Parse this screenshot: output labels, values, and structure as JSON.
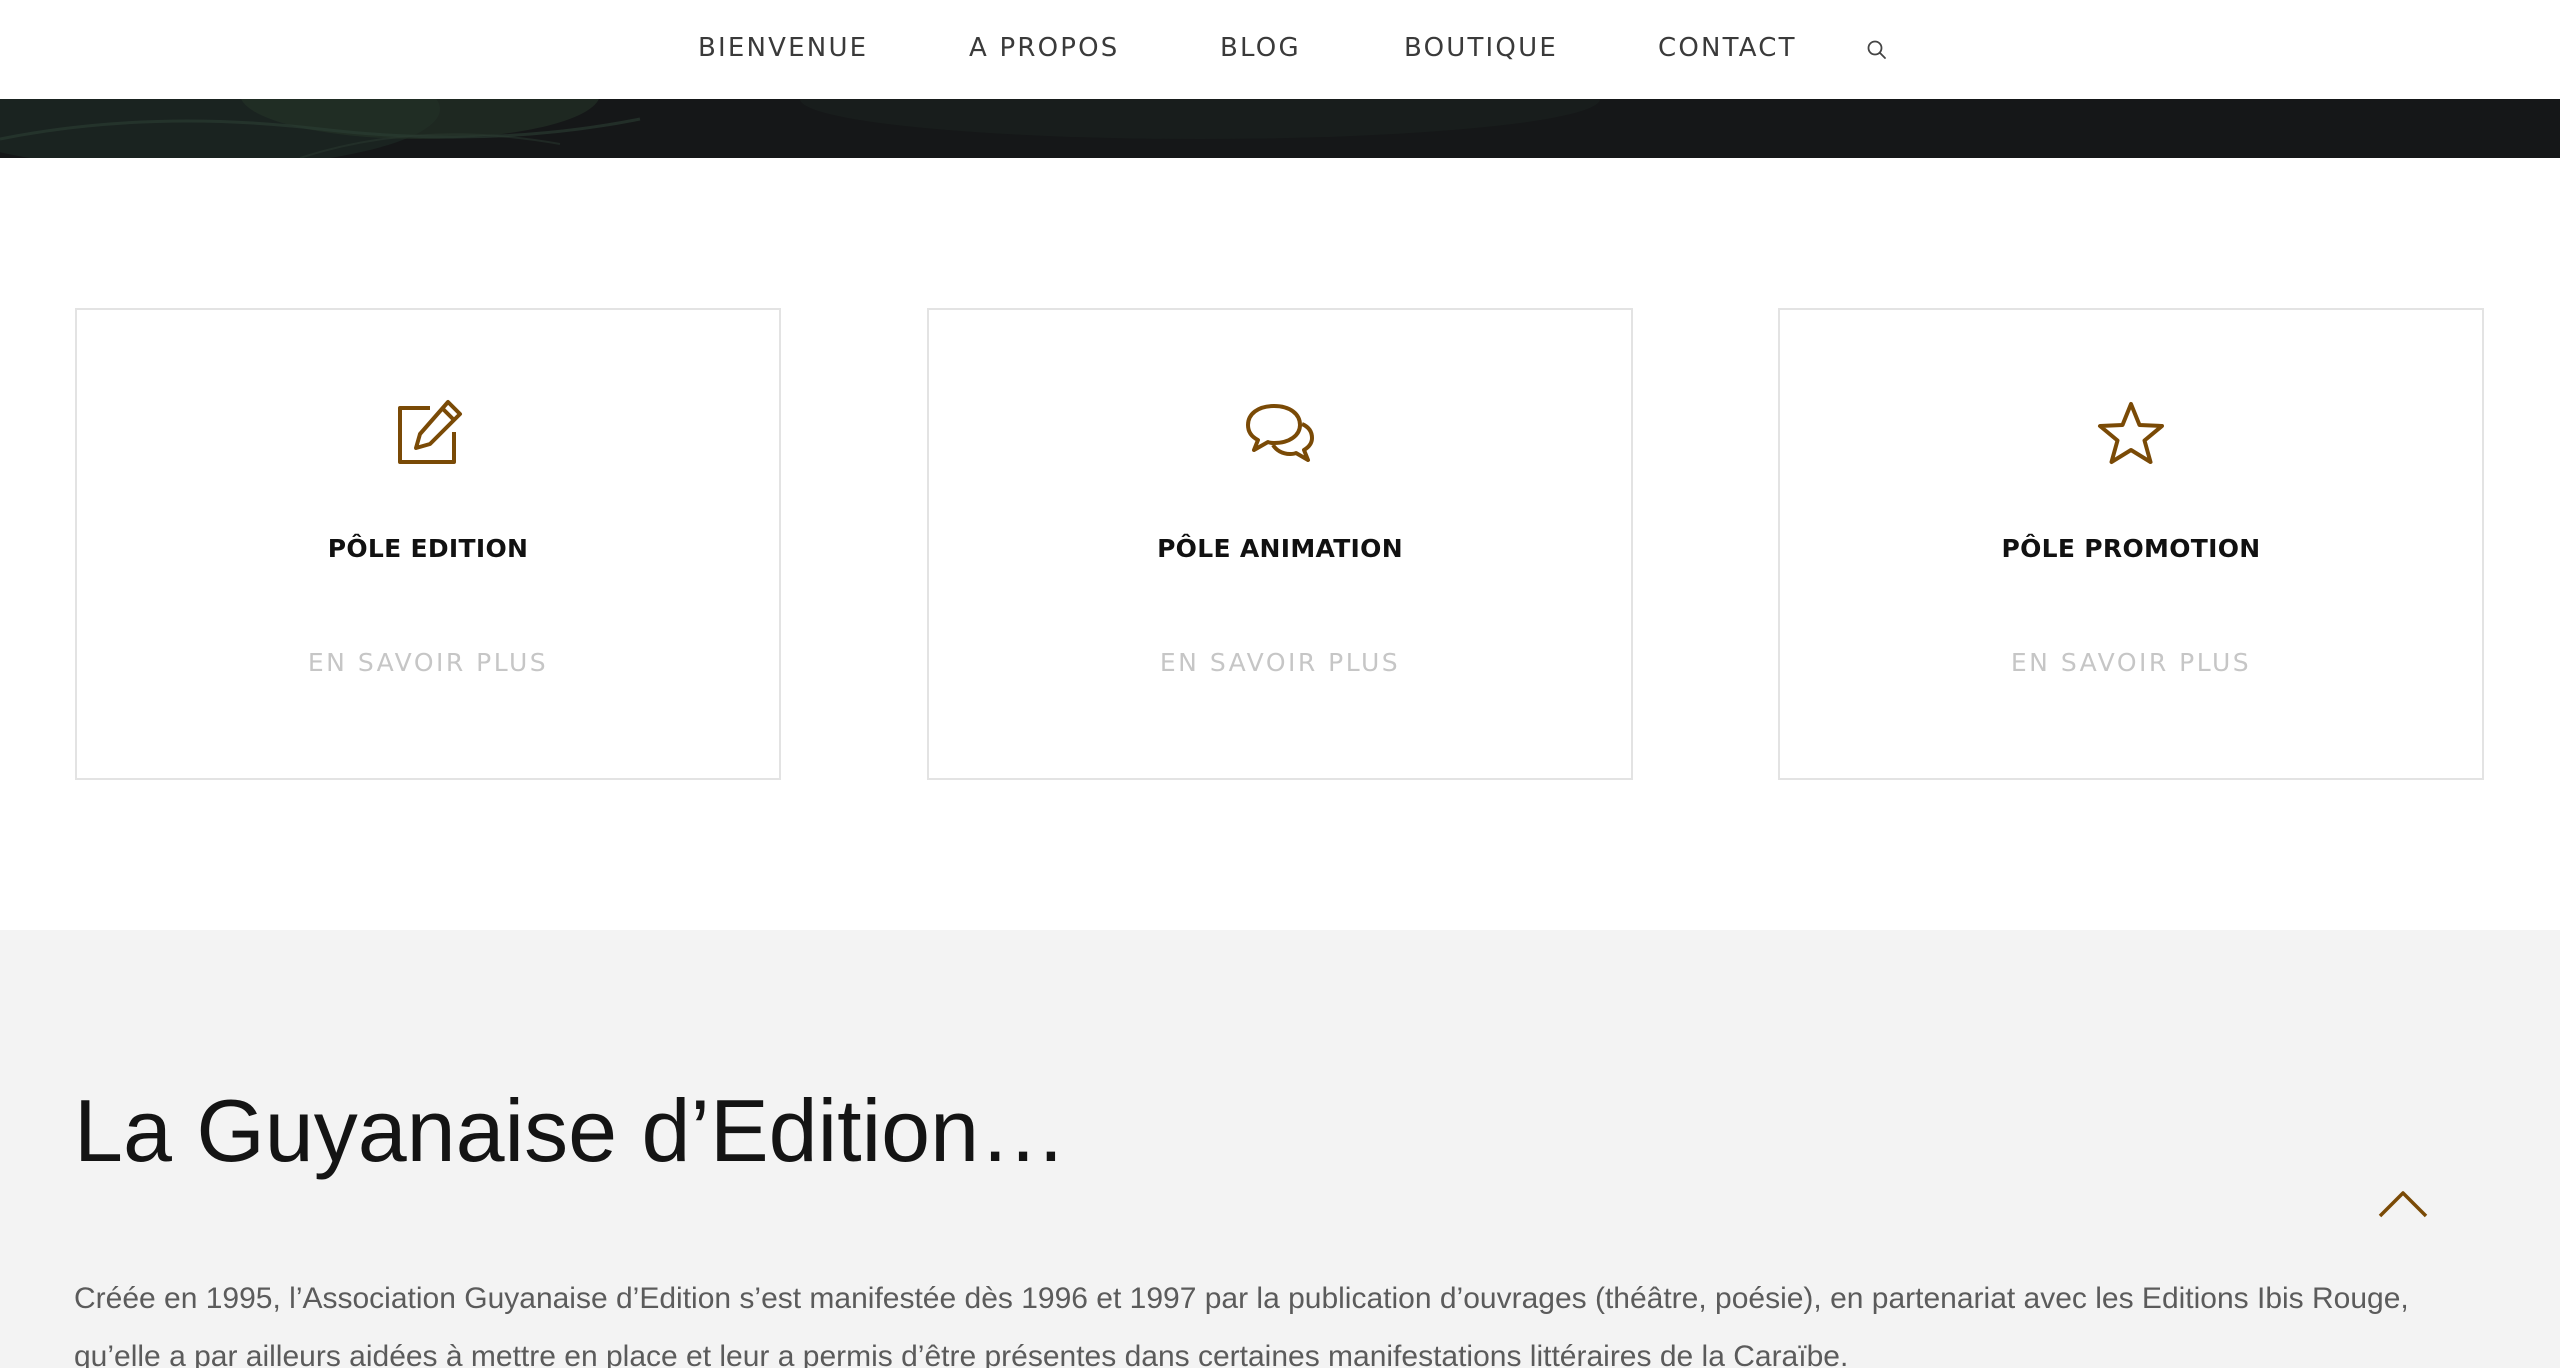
{
  "nav": {
    "items": [
      {
        "label": "BIENVENUE"
      },
      {
        "label": "A PROPOS"
      },
      {
        "label": "BLOG"
      },
      {
        "label": "BOUTIQUE"
      },
      {
        "label": "CONTACT"
      }
    ],
    "search_icon": "search-icon"
  },
  "colors": {
    "accent": "#7a4a06",
    "hero_bg": "#151718",
    "section_bg": "#f3f3f3",
    "card_border": "#e3e3e3",
    "link_muted": "#c6c6c6"
  },
  "cards": [
    {
      "icon": "edit-icon",
      "title": "PÔLE EDITION",
      "link": "EN SAVOIR PLUS"
    },
    {
      "icon": "chat-icon",
      "title": "PÔLE ANIMATION",
      "link": "EN SAVOIR PLUS"
    },
    {
      "icon": "star-icon",
      "title": "PÔLE PROMOTION",
      "link": "EN SAVOIR PLUS"
    }
  ],
  "about": {
    "title": "La Guyanaise d’Edition…",
    "text": "Créée en 1995, l’Association Guyanaise d’Edition s’est manifestée dès 1996 et 1997 par la publication d’ouvrages (théâtre, poésie), en partenariat avec les Editions Ibis Rouge, qu’elle a par ailleurs aidées à mettre en place et leur a permis d’être présentes dans certaines manifestations littéraires de la Caraïbe."
  },
  "scroll_top_icon": "chevron-up-icon"
}
